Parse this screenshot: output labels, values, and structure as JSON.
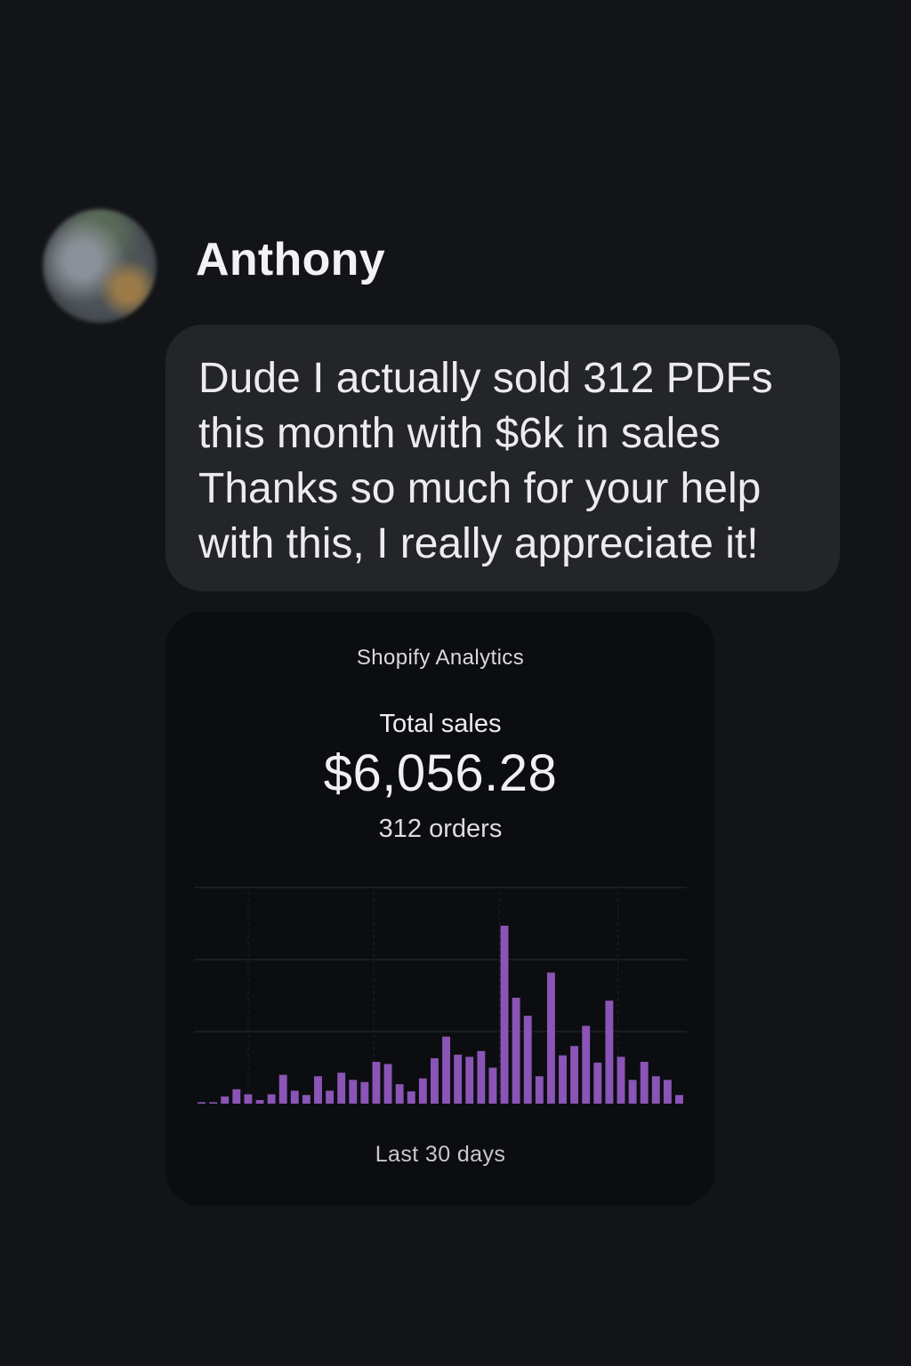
{
  "message": {
    "sender_name": "Anthony",
    "lines": [
      "Dude I actually sold 312 PDFs",
      "this month with $6k in sales",
      "Thanks so much for your help",
      "with this, I really appreciate it!"
    ]
  },
  "analytics_card": {
    "title": "Shopify Analytics",
    "metric_label": "Total sales",
    "metric_value": "$6,056.28",
    "orders_label": "312 orders",
    "period_label": "Last 30 days"
  },
  "colors": {
    "background": "#131417",
    "bubble": "#232528",
    "card": "#0c0d10",
    "bar": "#8a55b6",
    "grid": "#2a2b30"
  },
  "chart_data": {
    "type": "bar",
    "title": "",
    "xlabel": "",
    "ylabel": "",
    "ylim": [
      0,
      3
    ],
    "grid": true,
    "values": [
      0.02,
      0.02,
      0.1,
      0.2,
      0.13,
      0.05,
      0.13,
      0.4,
      0.18,
      0.12,
      0.38,
      0.18,
      0.43,
      0.33,
      0.3,
      0.58,
      0.55,
      0.27,
      0.17,
      0.35,
      0.63,
      0.93,
      0.68,
      0.65,
      0.73,
      0.5,
      2.47,
      1.47,
      1.22,
      0.38,
      1.82,
      0.67,
      0.8,
      1.08,
      0.57,
      1.43,
      0.65,
      0.33,
      0.58,
      0.38,
      0.33,
      0.12
    ]
  }
}
